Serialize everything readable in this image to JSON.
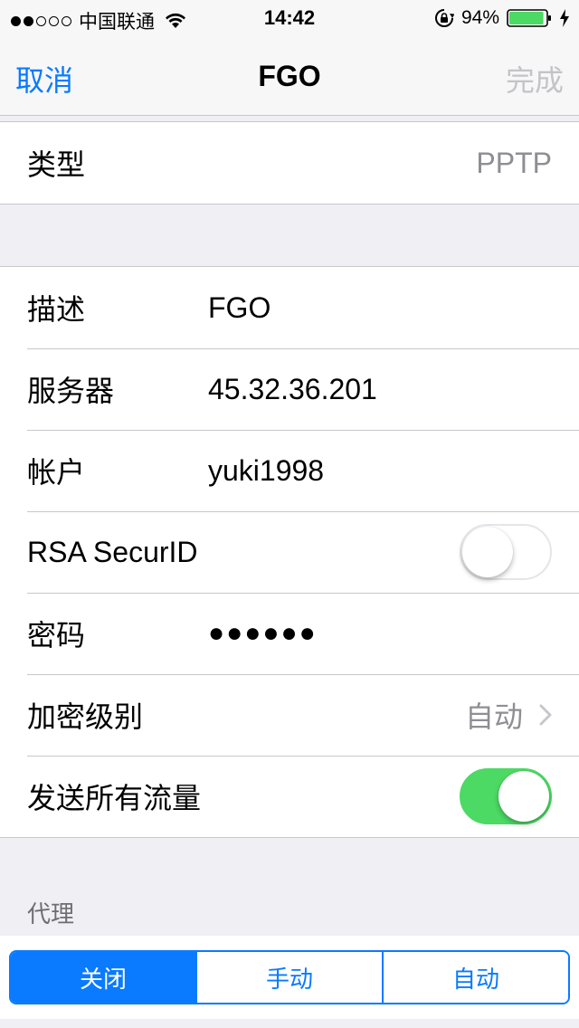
{
  "status_bar": {
    "carrier": "中国联通",
    "time": "14:42",
    "battery_percent": "94%",
    "battery_level": 0.94,
    "signal_bars": 2,
    "signal_total": 5
  },
  "nav": {
    "cancel_label": "取消",
    "title": "FGO",
    "done_label": "完成"
  },
  "type_row": {
    "label": "类型",
    "value": "PPTP"
  },
  "fields": {
    "description": {
      "label": "描述",
      "value": "FGO"
    },
    "server": {
      "label": "服务器",
      "value": "45.32.36.201"
    },
    "account": {
      "label": "帐户",
      "value": "yuki1998"
    },
    "rsa": {
      "label": "RSA SecurID",
      "enabled": false
    },
    "password": {
      "label": "密码",
      "value": "●●●●●●"
    },
    "encryption": {
      "label": "加密级别",
      "value": "自动"
    },
    "send_all_traffic": {
      "label": "发送所有流量",
      "enabled": true
    }
  },
  "proxy": {
    "header": "代理",
    "options": [
      "关闭",
      "手动",
      "自动"
    ],
    "selected_index": 0
  },
  "colors": {
    "accent": "#0a7aff",
    "toggle_on": "#4cd964",
    "disabled_text": "#c4c4c8",
    "secondary_text": "#8e8e93"
  },
  "icons": [
    "wifi-icon",
    "rotation-lock-icon",
    "battery-icon",
    "charging-bolt-icon",
    "chevron-right-icon"
  ]
}
